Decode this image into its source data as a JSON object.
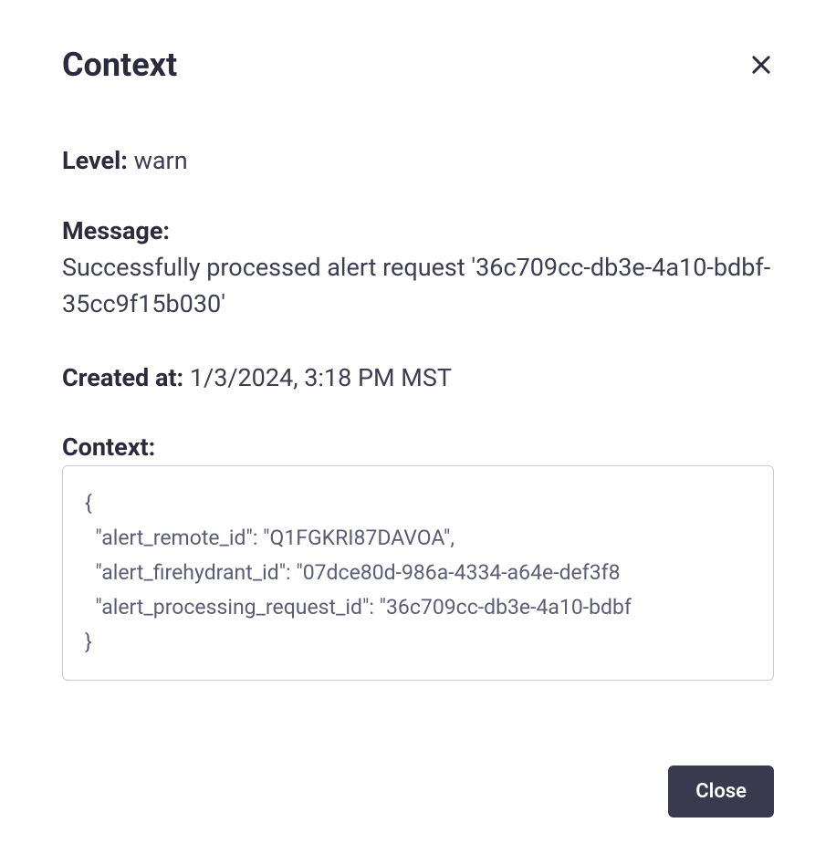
{
  "dialog": {
    "title": "Context",
    "close_button_label": "Close"
  },
  "fields": {
    "level": {
      "label": "Level:",
      "value": "warn"
    },
    "message": {
      "label": "Message:",
      "value": "Successfully processed alert request '36c709cc-db3e-4a10-bdbf-35cc9f15b030'"
    },
    "created_at": {
      "label": "Created at:",
      "value": "1/3/2024, 3:18 PM MST"
    },
    "context": {
      "label": "Context:",
      "json_text": "{\n  \"alert_remote_id\": \"Q1FGKRI87DAVOA\",\n  \"alert_firehydrant_id\": \"07dce80d-986a-4334-a64e-def3f8\n  \"alert_processing_request_id\": \"36c709cc-db3e-4a10-bdbf\n}"
    }
  }
}
